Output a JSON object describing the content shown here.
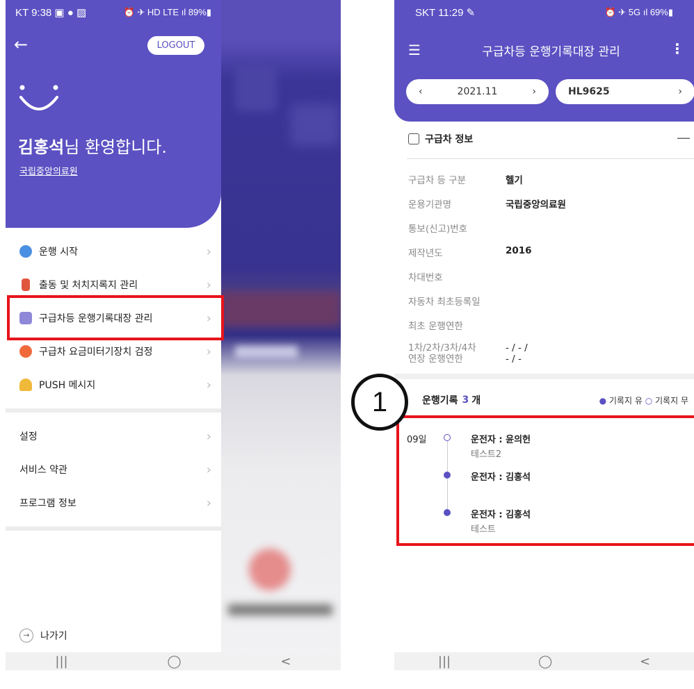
{
  "left": {
    "status": {
      "left": "KT 9:38 ▣ ● ▨",
      "right": "⏰ ✈ HD LTE ıl 89%▮"
    },
    "logout_label": "LOGOUT",
    "user_name": "김홍석",
    "welcome_suffix": "님 환영합니다.",
    "org": "국립중앙의료원",
    "menu": [
      {
        "label": "운행 시작",
        "color": "#4a90e2"
      },
      {
        "label": "출동 및 처치지록지 관리",
        "color": "#e0553d"
      },
      {
        "label": "구급차등 운행기록대장 관리",
        "color": "#5b51c2"
      },
      {
        "label": "구급차 요금미터기장치 검정",
        "color": "#f06a3a"
      },
      {
        "label": "PUSH 메시지",
        "color": "#f0b93a"
      }
    ],
    "settings": [
      {
        "label": "설정"
      },
      {
        "label": "서비스 약관"
      },
      {
        "label": "프로그램 정보"
      }
    ],
    "exit_label": "나가기",
    "nav": [
      "|||",
      "◯",
      "<"
    ]
  },
  "right": {
    "status": {
      "left": "SKT 11:29 ✎",
      "right": "⏰ ✈ 5G ıl 69%▮"
    },
    "title": "구급차등 운행기록대장 관리",
    "month": "2021.11",
    "vehicle": "HL9625",
    "section_title": "구급차 정보",
    "info": [
      {
        "k": "구급차 등 구분",
        "v": "헬기"
      },
      {
        "k": "운용기관명",
        "v": "국립중앙의료원"
      },
      {
        "k": "통보(신고)번호",
        "v": ""
      },
      {
        "k": "제작년도",
        "v": "2016"
      },
      {
        "k": "차대번호",
        "v": ""
      },
      {
        "k": "자동차 최초등록일",
        "v": ""
      },
      {
        "k": "최초 운행연한",
        "v": ""
      }
    ],
    "extend_k": "1차/2차/3차/4차\n연장 운행연한",
    "extend_v": "- / - /\n- / -",
    "records_title": "운행기록",
    "records_count": "3",
    "records_unit": "개",
    "legend_yes": "기록지 유",
    "legend_no": "기록지 무",
    "badge": "1",
    "records": [
      {
        "day": "09일",
        "driver": "운전자 : 윤의헌",
        "memo": "테스트2",
        "filled": false
      },
      {
        "day": "",
        "driver": "운전자 : 김홍석",
        "memo": "",
        "filled": true
      },
      {
        "day": "",
        "driver": "운전자 : 김홍석",
        "memo": "테스트",
        "filled": true
      }
    ],
    "nav": [
      "|||",
      "◯",
      "<"
    ]
  },
  "colors": {
    "brand": "#5b51c2",
    "highlight": "#e8141b"
  }
}
